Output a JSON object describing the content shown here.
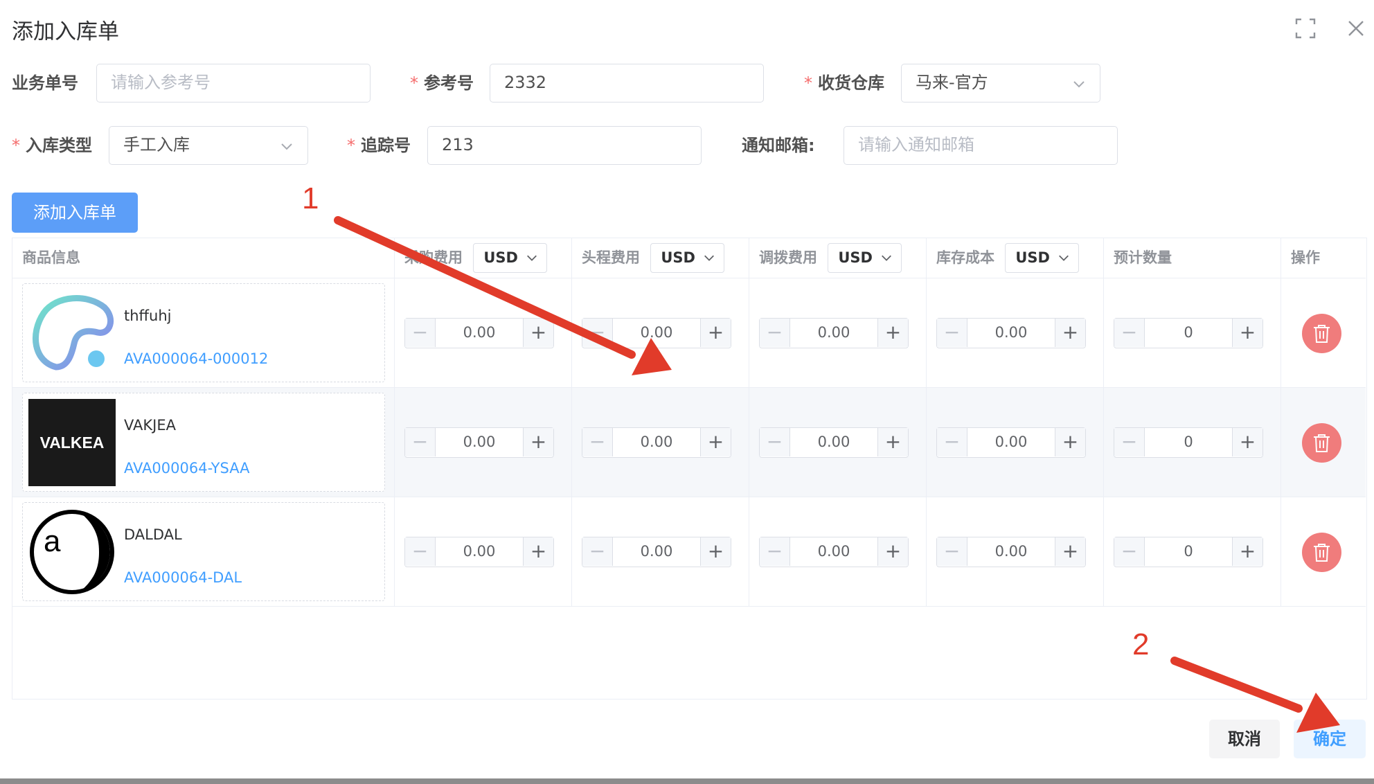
{
  "dialog": {
    "title": "添加入库单"
  },
  "form": {
    "business_no": {
      "label": "业务单号",
      "placeholder": "请输入参考号",
      "value": ""
    },
    "reference_no": {
      "label": "参考号",
      "value": "2332"
    },
    "warehouse": {
      "label": "收货仓库",
      "value": "马来-官方"
    },
    "inbound_type": {
      "label": "入库类型",
      "value": "手工入库"
    },
    "tracking_no": {
      "label": "追踪号",
      "value": "213"
    },
    "notify_email": {
      "label": "通知邮箱:",
      "placeholder": "请输入通知邮箱",
      "value": ""
    },
    "required_mark": "*"
  },
  "add_button_label": "添加入库单",
  "table": {
    "headers": {
      "product": "商品信息",
      "purchase": "采购费用",
      "first_leg": "头程费用",
      "transfer": "调拨费用",
      "stock_cost": "库存成本",
      "expected_qty": "预计数量",
      "action": "操作"
    },
    "currency": "USD",
    "rows": [
      {
        "name": "thffuhj",
        "sku": "AVA000064-000012",
        "purchase": "0.00",
        "first_leg": "0.00",
        "transfer": "0.00",
        "stock_cost": "0.00",
        "qty": "0"
      },
      {
        "name": "VAKJEA",
        "sku": "AVA000064-YSAA",
        "purchase": "0.00",
        "first_leg": "0.00",
        "transfer": "0.00",
        "stock_cost": "0.00",
        "qty": "0",
        "logo_text": "VALKEA"
      },
      {
        "name": "DALDAL",
        "sku": "AVA000064-DAL",
        "purchase": "0.00",
        "first_leg": "0.00",
        "transfer": "0.00",
        "stock_cost": "0.00",
        "qty": "0",
        "logo_text": "a"
      }
    ],
    "stepper_minus": "−",
    "stepper_plus": "+"
  },
  "footer": {
    "cancel_label": "取消",
    "confirm_label": "确定"
  },
  "annotations": {
    "arrow1_label": "1",
    "arrow2_label": "2",
    "arrow_color": "#e13b2a"
  },
  "colors": {
    "primary": "#5c9ef8",
    "link": "#409eff",
    "danger": "#f07c7c",
    "required": "#f56c6c"
  }
}
